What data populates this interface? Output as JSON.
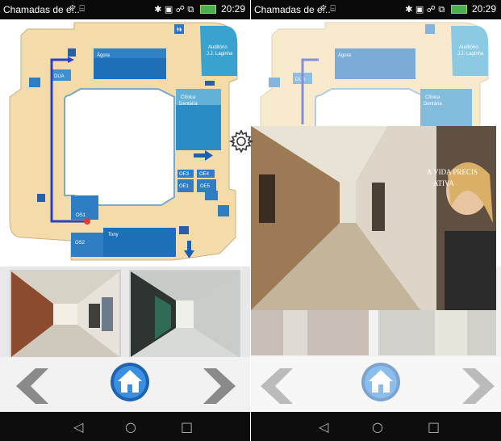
{
  "status_bar": {
    "title": "Chamadas de e...",
    "notification_icons": "♆ ⌸",
    "system_icons": "✱ ▣ ☍ ⧉",
    "time": "20:29"
  },
  "map": {
    "rooms": {
      "agora": "Ágora",
      "auditorio_line1": "Auditório",
      "auditorio_line2": "J.J. Laginha",
      "clinica_line1": "Clínica",
      "clinica_line2": "Dentária",
      "dua": "DUA",
      "oe3": "OE3",
      "oe4": "OE4",
      "oe1": "OE1",
      "oe5": "OE5",
      "os1": "OS1",
      "os2": "OS2",
      "tony": "Tony"
    },
    "icons": [
      "wc-icon",
      "stairs-icon",
      "elevator-icon",
      "entrance-arrow-icon",
      "exit-arrow-icon"
    ]
  },
  "photos": [
    {
      "name": "corridor-photo",
      "description_icon": "photo-icon"
    },
    {
      "name": "lockers-corridor-photo",
      "description_icon": "photo-icon"
    }
  ],
  "overlay_photo": {
    "poster_text_line1": "A VIDA PRECIS",
    "poster_text_line2": "ATIVA"
  },
  "navigation": {
    "prev_icon": "chevron-left-icon",
    "home_icon": "home-icon",
    "next_icon": "chevron-right-icon",
    "settings_icon": "gear-icon"
  },
  "system_nav": {
    "back": "◁",
    "home": "○",
    "recents": "□"
  },
  "colors": {
    "map_floor": "#f3dcaa",
    "map_room": "#1d6fb8",
    "route": "#2f3fbf",
    "arrow_gray": "#8a8a8a",
    "status_bar": "#0a0a0a"
  }
}
